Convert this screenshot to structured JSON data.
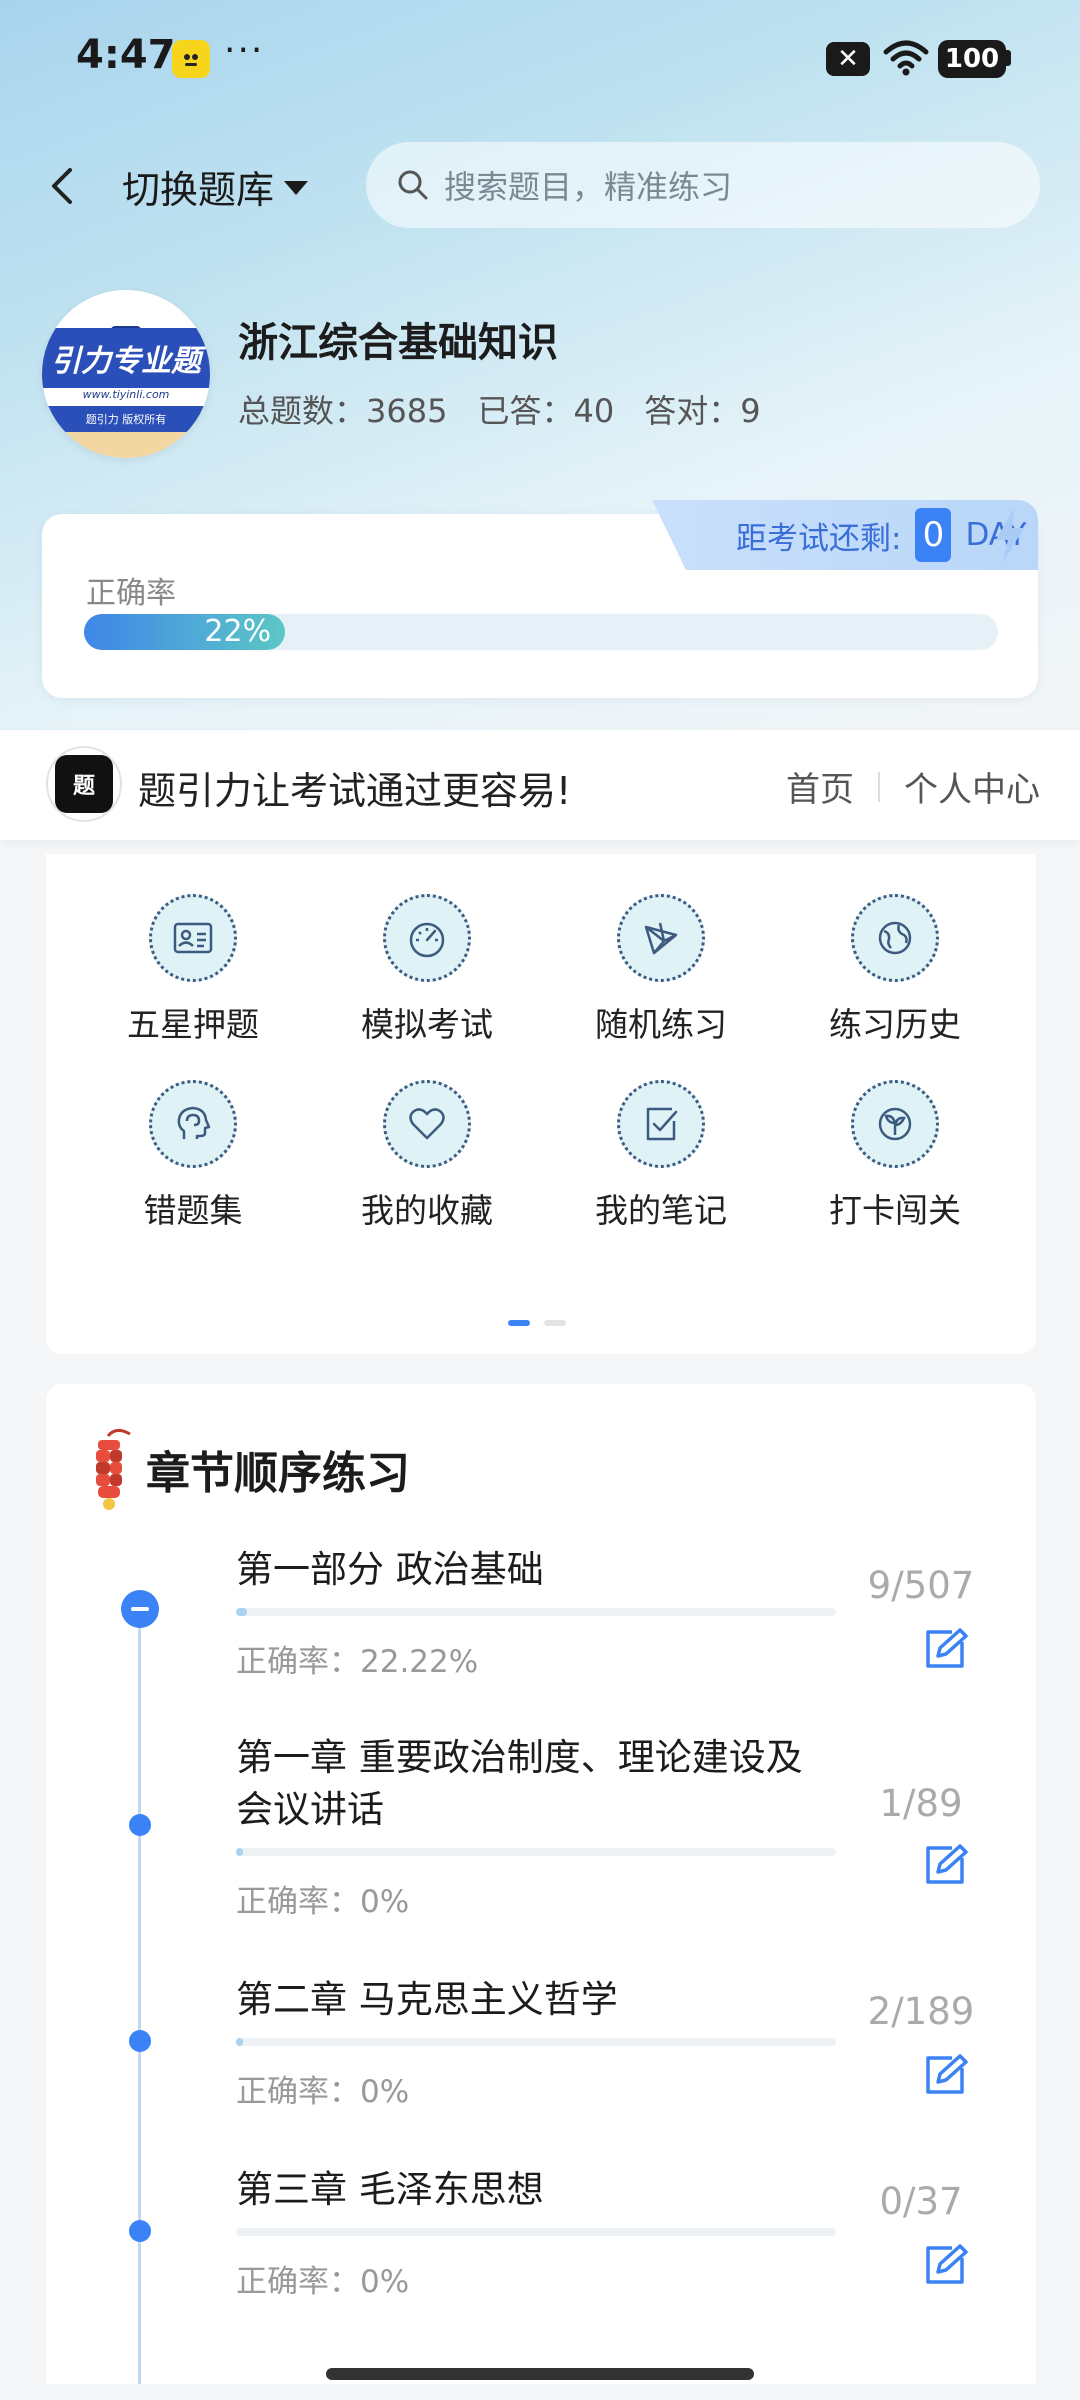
{
  "status": {
    "time": "4:47",
    "dots": "···",
    "battery": "100"
  },
  "topbar": {
    "switch_label": "切换题库",
    "search_placeholder": "搜索题目，精准练习"
  },
  "bank": {
    "logo_text": "引力专业题",
    "logo_url": "www.tiyinli.com",
    "logo_footer": "题引力 版权所有",
    "title": "浙江综合基础知识",
    "total_label": "总题数：",
    "total_value": "3685",
    "answered_label": "已答：",
    "answered_value": "40",
    "correct_label": "答对：",
    "correct_value": "9"
  },
  "accuracy": {
    "countdown_label": "距考试还剩:",
    "countdown_value": "0",
    "countdown_unit": "DAY",
    "label": "正确率",
    "percent_text": "22%",
    "percent": 22
  },
  "brand": {
    "slogan": "题引力让考试通过更容易!",
    "nav_home": "首页",
    "nav_profile": "个人中心"
  },
  "features": [
    {
      "label": "五星押题",
      "icon": "id-card-icon"
    },
    {
      "label": "模拟考试",
      "icon": "gauge-icon"
    },
    {
      "label": "随机练习",
      "icon": "shuffle-icon"
    },
    {
      "label": "练习历史",
      "icon": "globe-icon"
    },
    {
      "label": "错题集",
      "icon": "brain-head-icon"
    },
    {
      "label": "我的收藏",
      "icon": "heart-icon"
    },
    {
      "label": "我的笔记",
      "icon": "note-check-icon"
    },
    {
      "label": "打卡闯关",
      "icon": "sprout-icon"
    }
  ],
  "chapters": {
    "title": "章节顺序练习",
    "items": [
      {
        "name": "第一部分 政治基础",
        "accuracy": "正确率：22.22%",
        "count": "9/507",
        "progress": 0.018
      },
      {
        "name": "第一章 重要政治制度、理论建设及会议讲话",
        "accuracy": "正确率：0%",
        "count": "1/89",
        "progress": 0.011
      },
      {
        "name": "第二章 马克思主义哲学",
        "accuracy": "正确率：0%",
        "count": "2/189",
        "progress": 0.011
      },
      {
        "name": "第三章 毛泽东思想",
        "accuracy": "正确率：0%",
        "count": "0/37",
        "progress": 0
      }
    ]
  },
  "colors": {
    "accent": "#3b82f6",
    "icon_bg": "#dff3f7",
    "icon_stroke": "#3d5a80"
  }
}
